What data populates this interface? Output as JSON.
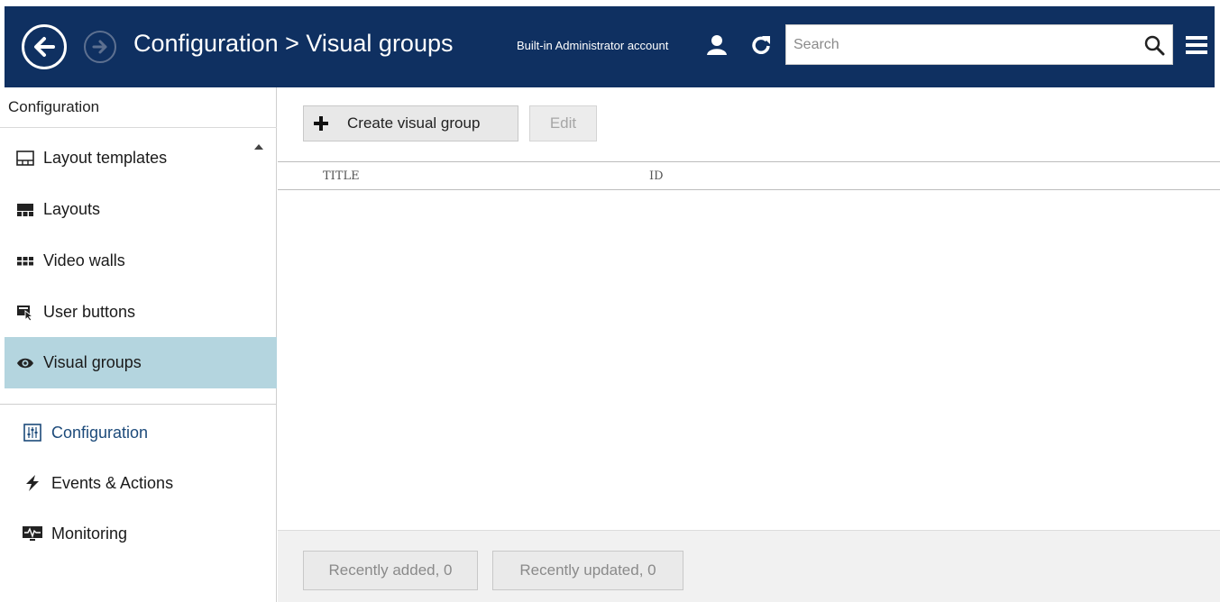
{
  "header": {
    "title": "Configuration > Visual groups",
    "account": "Built-in Administrator account",
    "search_placeholder": "Search",
    "background": "#0f3061"
  },
  "sidebar": {
    "title": "Configuration",
    "items": [
      {
        "label": "Layout templates",
        "icon": "layout-template-icon"
      },
      {
        "label": "Layouts",
        "icon": "layouts-icon"
      },
      {
        "label": "Video walls",
        "icon": "video-wall-icon"
      },
      {
        "label": "User buttons",
        "icon": "user-button-icon"
      },
      {
        "label": "Visual groups",
        "icon": "eye-icon",
        "active": true
      }
    ],
    "active_color": "#b4d5df",
    "modes": [
      {
        "label": "Configuration",
        "icon": "configuration-icon",
        "current": true
      },
      {
        "label": "Events & Actions",
        "icon": "lightning-icon"
      },
      {
        "label": "Monitoring",
        "icon": "monitoring-icon"
      }
    ]
  },
  "toolbar": {
    "create_label": "Create visual group",
    "edit_label": "Edit"
  },
  "table": {
    "columns": [
      "TITLE",
      "ID"
    ],
    "rows": []
  },
  "footer": {
    "recently_added": "Recently added, 0",
    "recently_updated": "Recently updated, 0"
  }
}
